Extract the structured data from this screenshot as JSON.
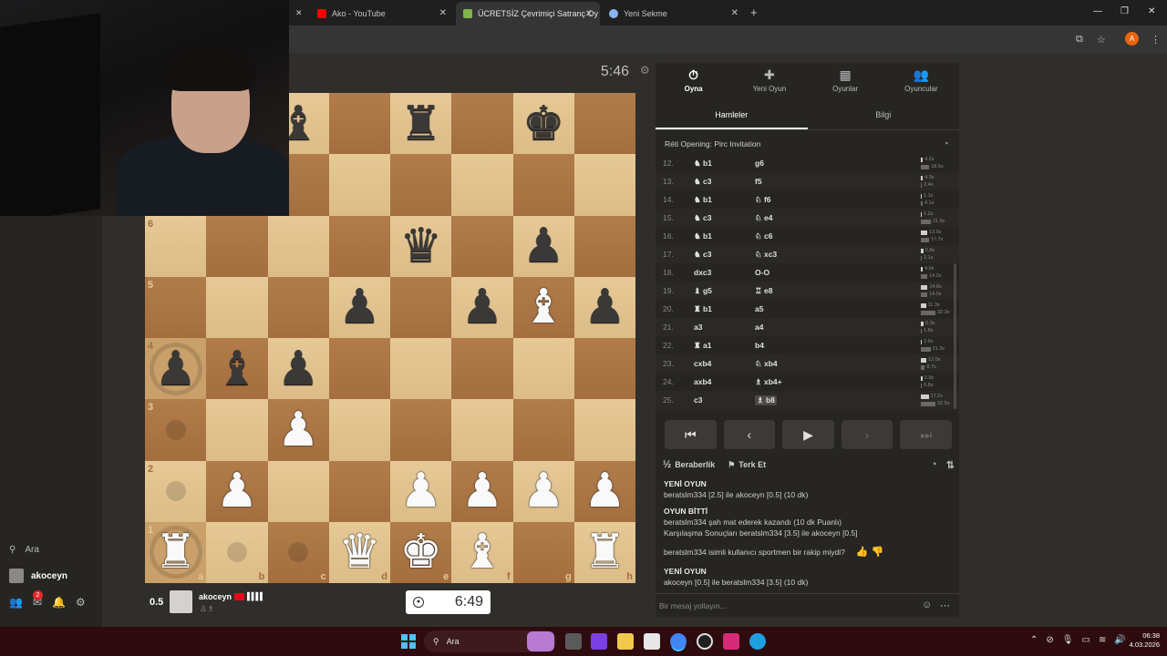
{
  "browser": {
    "tabs": [
      {
        "title": "Ako - YouTube",
        "favicon_color": "#ff0000"
      },
      {
        "title": "ÜCRETSİZ Çevrimiçi Satranç Oy",
        "favicon_color": "#81b64c"
      },
      {
        "title": "Yeni Sekme",
        "favicon_color": "#8ab4f8"
      }
    ],
    "profile_initial": "A"
  },
  "leftnav": {
    "search_label": "Ara",
    "username": "akoceyn",
    "notification_count": "2"
  },
  "game": {
    "opponent_timer": "5:46",
    "player_timer": "6:49",
    "player_score": "0.5",
    "player_name": "akoceyn",
    "player_signal": "▌▌▌▌",
    "board": {
      "ranks": [
        "8",
        "7",
        "6",
        "5",
        "4",
        "3",
        "2",
        "1"
      ],
      "files": [
        "a",
        "b",
        "c",
        "d",
        "e",
        "f",
        "g",
        "h"
      ],
      "rows": [
        [
          "",
          "",
          "b:bishop",
          "",
          "b:rook",
          "",
          "b:king",
          ""
        ],
        [
          "",
          "",
          "",
          "",
          "",
          "",
          "",
          ""
        ],
        [
          "",
          "",
          "",
          "",
          "b:queen",
          "",
          "b:pawn",
          ""
        ],
        [
          "",
          "",
          "",
          "b:pawn",
          "",
          "b:pawn",
          "w:bishop",
          "b:pawn"
        ],
        [
          "b:pawn",
          "b:bishop",
          "b:pawn",
          "",
          "",
          "",
          "",
          ""
        ],
        [
          "",
          "",
          "w:pawn",
          "",
          "",
          "",
          "",
          ""
        ],
        [
          "",
          "w:pawn",
          "",
          "",
          "w:pawn",
          "w:pawn",
          "w:pawn",
          "w:pawn"
        ],
        [
          "w:rook",
          "",
          "",
          "w:queen",
          "w:king",
          "w:bishop",
          "",
          "w:rook"
        ]
      ],
      "last_move_squares": [
        "a1",
        "a4"
      ],
      "move_dots": [
        "a3",
        "a2",
        "b1",
        "c1"
      ]
    }
  },
  "panel": {
    "tabs": [
      {
        "label": "Oyna",
        "icon": "stopwatch-icon",
        "glyph": "⏱"
      },
      {
        "label": "Yeni Oyun",
        "icon": "plus-icon",
        "glyph": "✚"
      },
      {
        "label": "Oyunlar",
        "icon": "chessboard-icon",
        "glyph": "▦"
      },
      {
        "label": "Oyuncular",
        "icon": "players-icon",
        "glyph": "👥"
      }
    ],
    "subtabs": [
      "Hamleler",
      "Bilgi"
    ],
    "opening": "Réti Opening: Pirc Invitation",
    "moves": [
      {
        "n": "12.",
        "w": "♞ b1",
        "b": "g6",
        "tw": "4.2s",
        "tb": "18.5s"
      },
      {
        "n": "13.",
        "w": "♞ c3",
        "b": "f5",
        "tw": "4.3s",
        "tb": "2.4s"
      },
      {
        "n": "14.",
        "w": "♞ b1",
        "b": "♘ f6",
        "tw": "1.1s",
        "tb": "4.1s"
      },
      {
        "n": "15.",
        "w": "♞ c3",
        "b": "♘ e4",
        "tw": "1.2s",
        "tb": "21.9s"
      },
      {
        "n": "16.",
        "w": "♞ b1",
        "b": "♘ c6",
        "tw": "13.9s",
        "tb": "17.7s"
      },
      {
        "n": "17.",
        "w": "♞ c3",
        "b": "♘ xc3",
        "tw": "5.8s",
        "tb": "2.1s"
      },
      {
        "n": "18.",
        "w": "dxc3",
        "b": "O-O",
        "tw": "4.0s",
        "tb": "14.2s"
      },
      {
        "n": "19.",
        "w": "♝ g5",
        "b": "♖ e8",
        "tw": "14.8s",
        "tb": "14.0s"
      },
      {
        "n": "20.",
        "w": "♜ b1",
        "b": "a5",
        "tw": "11.3s",
        "tb": "32.3s"
      },
      {
        "n": "21.",
        "w": "a3",
        "b": "a4",
        "tw": "6.3s",
        "tb": "1.8s"
      },
      {
        "n": "22.",
        "w": "♜ a1",
        "b": "b4",
        "tw": "2.6s",
        "tb": "21.3s"
      },
      {
        "n": "23.",
        "w": "cxb4",
        "b": "♘ xb4",
        "tw": "12.0s",
        "tb": "8.7s"
      },
      {
        "n": "24.",
        "w": "axb4",
        "b": "♗ xb4+",
        "tw": "3.3s",
        "tb": "0.8s"
      },
      {
        "n": "25.",
        "w": "c3",
        "b": "♗ b8",
        "tw": "17.2s",
        "tb": "32.5s"
      }
    ],
    "actions": {
      "draw": "Beraberlik",
      "resign": "Terk Et",
      "draw_icon": "½"
    },
    "chat": {
      "lines": [
        {
          "head": "YENİ OYUN"
        },
        {
          "text": "beratslm334 [2.5] ile akoceyn [0.5] (10 dk)"
        },
        {
          "gap": true
        },
        {
          "head": "OYUN BİTTİ"
        },
        {
          "text": "beratslm334 şah mat ederek kazandı (10 dk Puanlı)"
        },
        {
          "text": "Karşılaşma Sonuçları beratslm334 [3.5] ile akoceyn [0.5]"
        },
        {
          "gap": true
        },
        {
          "text": "beratslm334 isimli kullanıcı sportmen bir rakip miydi?",
          "thumbs": true
        },
        {
          "gap": true
        },
        {
          "head": "YENİ OYUN"
        },
        {
          "text": "akoceyn [0.5] ile beratslm334 [3.5] (10 dk)"
        }
      ],
      "placeholder": "Bir mesaj yollayın..."
    }
  },
  "taskbar": {
    "search_label": "Ara",
    "time": "06:38",
    "date": "4.03.2026"
  }
}
